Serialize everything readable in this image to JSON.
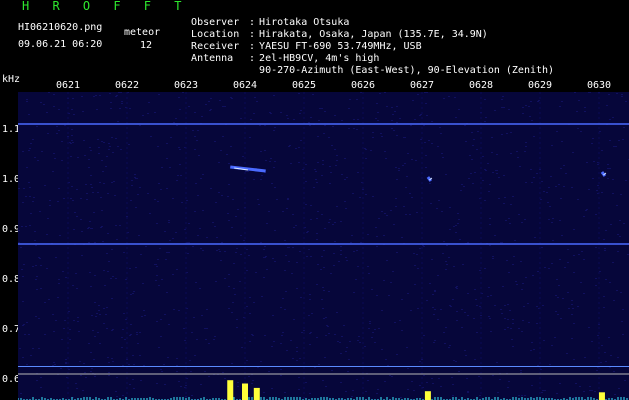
{
  "header": {
    "title": "H R O F F T",
    "filename": "HI06210620.png",
    "datetime": "09.06.21 06:20",
    "meteor_label": "meteor",
    "meteor_count": "12"
  },
  "metadata": [
    {
      "key": "Observer",
      "value": "Hirotaka Otsuka"
    },
    {
      "key": "Location",
      "value": "Hirakata, Osaka, Japan (135.7E, 34.9N)"
    },
    {
      "key": "Receiver",
      "value": "YAESU FT-690 53.749MHz, USB"
    },
    {
      "key": "Antenna",
      "value": "2el-HB9CV, 4m's high"
    },
    {
      "key": "",
      "value": "90-270-Azimuth (East-West), 90-Elevation (Zenith)"
    }
  ],
  "axis": {
    "y_unit": "kHz",
    "time_ticks": [
      "0621",
      "0622",
      "0623",
      "0624",
      "0625",
      "0626",
      "0627",
      "0628",
      "0629",
      "0630"
    ],
    "freq_ticks": [
      "1.1",
      "1.0",
      "0.9",
      "0.8",
      "0.7",
      "0.6"
    ]
  },
  "colors": {
    "title": "#2ee82e",
    "text": "#ffffff",
    "background": "#000000",
    "noise": "#06063a",
    "grid": "#1c2aa8",
    "signal_line": "#4a6aff",
    "signal_peak": "#d8e8ff",
    "baseline": "#5a8aff",
    "ref_line": "#b8b8b8",
    "histogram_main": "#ffff3a",
    "histogram_alt": "#38e8ff"
  },
  "chart_data": {
    "type": "heatmap",
    "x_range_min": [
      621,
      631
    ],
    "y_range_khz": [
      0.58,
      1.2
    ],
    "horizontal_signals_khz": [
      1.11,
      0.87
    ],
    "meteor_echoes": [
      {
        "minute_start": 623.75,
        "minute_end": 624.35,
        "khz": 1.02
      },
      {
        "minute_start": 627.1,
        "minute_end": 627.15,
        "khz": 1.0
      },
      {
        "minute_start": 630.05,
        "minute_end": 630.1,
        "khz": 1.01
      }
    ],
    "histogram_peaks": [
      {
        "minute": 623.75,
        "strength": 0.9
      },
      {
        "minute": 624.0,
        "strength": 0.75
      },
      {
        "minute": 624.2,
        "strength": 0.55
      },
      {
        "minute": 627.1,
        "strength": 0.4
      },
      {
        "minute": 630.05,
        "strength": 0.35
      }
    ]
  }
}
